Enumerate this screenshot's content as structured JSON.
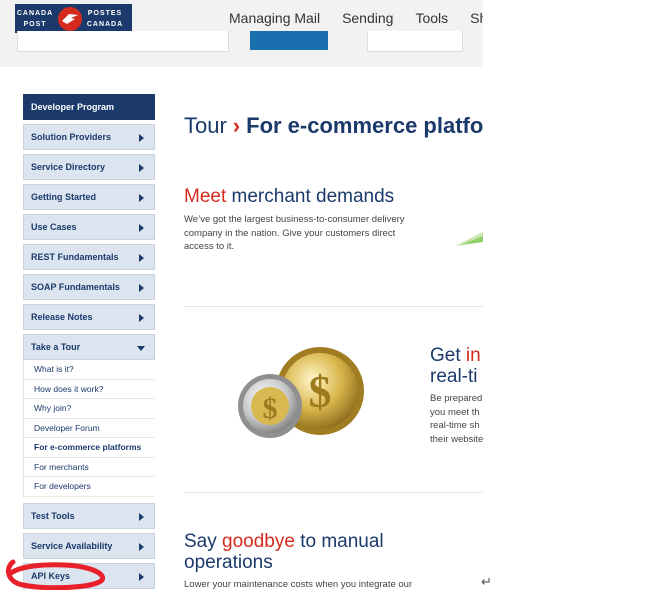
{
  "logo": {
    "line1_left": "CANADA",
    "line2_left": "POST",
    "line1_right": "POSTES",
    "line2_right": "CANADA",
    "brand_color": "#1b3a6b",
    "mark_color": "#d52b1e"
  },
  "topnav": [
    "Managing Mail",
    "Sending",
    "Tools",
    "Shop"
  ],
  "sidebar": {
    "header": "Developer Program",
    "items_before": [
      "Solution Providers",
      "Service Directory",
      "Getting Started",
      "Use Cases",
      "REST Fundamentals",
      "SOAP Fundamentals",
      "Release Notes"
    ],
    "open_item": "Take a Tour",
    "sub_items": [
      "What is it?",
      "How does it work?",
      "Why join?",
      "Developer Forum",
      "For e-commerce platforms",
      "For merchants",
      "For developers"
    ],
    "active_sub_item": "For e-commerce platforms",
    "items_after": [
      "Test Tools",
      "Service Availability",
      "API Keys"
    ]
  },
  "main": {
    "title_prefix": "Tour",
    "title_sep": "›",
    "title_main": "For e-commerce platfo",
    "sec1": {
      "heading_red": "Meet",
      "heading_rest": " merchant demands",
      "body": "We’ve got the largest business-to-consumer delivery company in the nation. Give your customers direct access to it."
    },
    "sec2": {
      "heading_line1_blue": "Get ",
      "heading_line1_red": "in",
      "heading_line2": "real-ti",
      "body_lines": [
        "Be prepared",
        "you meet th",
        "real-time sh",
        "their website"
      ]
    },
    "sec3": {
      "heading_pre": "Say ",
      "heading_red": "goodbye",
      "heading_post": " to manual",
      "heading_line2": "operations",
      "body": "Lower your maintenance costs when you integrate our"
    }
  },
  "annotation_color": "#e8202a",
  "return_glyph": "↵"
}
